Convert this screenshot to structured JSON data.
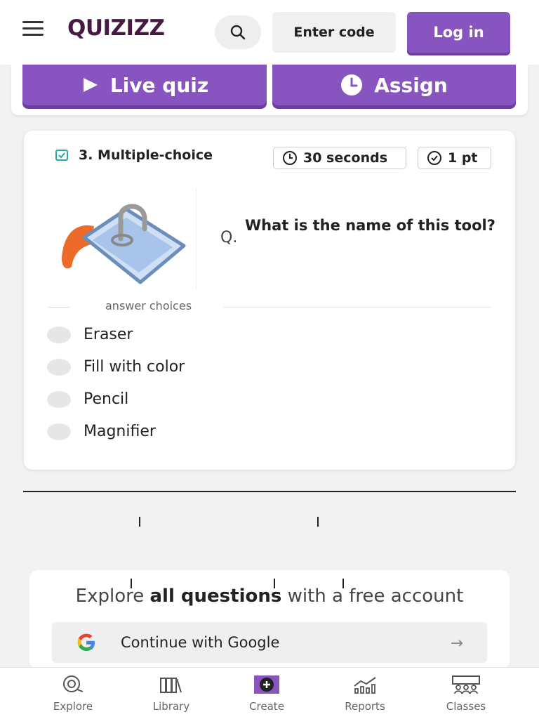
{
  "header": {
    "logo": "QUIZIZZ",
    "enter_code_label": "Enter code",
    "login_label": "Log in"
  },
  "actions": {
    "live_quiz_label": "Live quiz",
    "assign_label": "Assign"
  },
  "question": {
    "type_label": "3. Multiple-choice",
    "time_label": "30 seconds",
    "points_label": "1 pt",
    "prefix": "Q.",
    "text": "What is the name of this tool?",
    "answer_choices_label": "answer choices",
    "choices": [
      "Eraser",
      "Fill with color",
      "Pencil",
      "Magnifier"
    ]
  },
  "explore": {
    "prefix": "Explore ",
    "bold": "all questions",
    "suffix": " with a free account",
    "google_label": "Continue with Google"
  },
  "bottom_nav": {
    "items": [
      {
        "label": "Explore",
        "icon": "explore-icon"
      },
      {
        "label": "Library",
        "icon": "library-icon"
      },
      {
        "label": "Create",
        "icon": "create-icon"
      },
      {
        "label": "Reports",
        "icon": "reports-icon"
      },
      {
        "label": "Classes",
        "icon": "classes-icon"
      }
    ]
  },
  "colors": {
    "brand_purple": "#8854c0",
    "logo": "#461a42"
  }
}
